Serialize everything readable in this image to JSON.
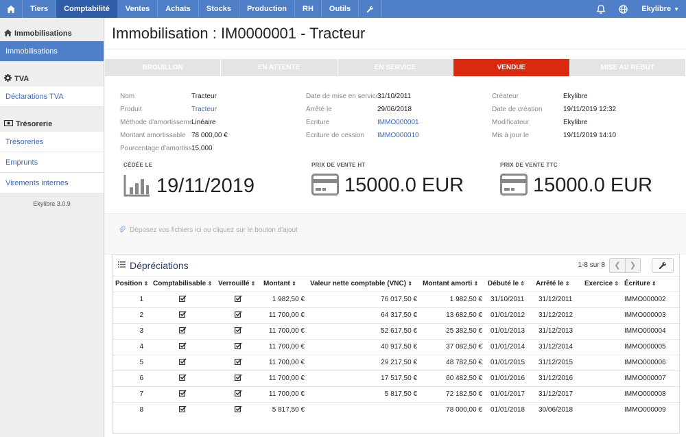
{
  "topbar": {
    "nav": [
      {
        "label": "Tiers",
        "active": false
      },
      {
        "label": "Comptabilité",
        "active": true
      },
      {
        "label": "Ventes",
        "active": false
      },
      {
        "label": "Achats",
        "active": false
      },
      {
        "label": "Stocks",
        "active": false
      },
      {
        "label": "Production",
        "active": false
      },
      {
        "label": "RH",
        "active": false
      },
      {
        "label": "Outils",
        "active": false
      }
    ],
    "user": "Ekylibre"
  },
  "sidebar": {
    "sections": [
      {
        "title": "Immobilisations",
        "icon": "home-icon",
        "links": [
          {
            "label": "Immobilisations",
            "active": true
          }
        ]
      },
      {
        "title": "TVA",
        "icon": "gear-icon",
        "links": [
          {
            "label": "Déclarations TVA",
            "active": false
          }
        ]
      },
      {
        "title": "Trésorerie",
        "icon": "banknote-icon",
        "links": [
          {
            "label": "Trésoreries",
            "active": false
          },
          {
            "label": "Emprunts",
            "active": false
          },
          {
            "label": "Virements internes",
            "active": false
          }
        ]
      }
    ],
    "version": "Ekylibre 3.0.9"
  },
  "page": {
    "title": "Immobilisation : IM0000001 - Tracteur"
  },
  "status": {
    "steps": [
      "Brouillon",
      "En attente",
      "En service",
      "Vendue",
      "Mise au rebut"
    ],
    "active": "Vendue",
    "active_color": "#d9290e"
  },
  "fields": {
    "col1": [
      {
        "label": "Nom",
        "value": "Tracteur",
        "link": false
      },
      {
        "label": "Produit",
        "value": "Tracteur",
        "link": true
      },
      {
        "label": "Méthode d'amortissement",
        "value": "Linéaire",
        "link": false
      },
      {
        "label": "Montant amortissable",
        "value": "78 000,00 €",
        "link": false
      },
      {
        "label": "Pourcentage d'amortissement",
        "value": "15,000",
        "link": false
      }
    ],
    "col2": [
      {
        "label": "Date de mise en service",
        "value": "31/10/2011",
        "link": false
      },
      {
        "label": "Arrêté le",
        "value": "29/06/2018",
        "link": false
      },
      {
        "label": "Écriture",
        "value": "IMMO000001",
        "link": true
      },
      {
        "label": "Ecriture de cession",
        "value": "IMMO000010",
        "link": true
      }
    ],
    "col3": [
      {
        "label": "Créateur",
        "value": "Ekylibre",
        "link": false
      },
      {
        "label": "Date de création",
        "value": "19/11/2019 12:32",
        "link": false
      },
      {
        "label": "Modificateur",
        "value": "Ekylibre",
        "link": false
      },
      {
        "label": "Mis à jour le",
        "value": "19/11/2019 14:10",
        "link": false
      }
    ]
  },
  "kpis": [
    {
      "label": "Cédée le",
      "value": "19/11/2019",
      "icon": "bar-chart-icon"
    },
    {
      "label": "Prix de vente HT",
      "value": "15000.0 EUR",
      "icon": "credit-card-icon"
    },
    {
      "label": "Prix de vente TTC",
      "value": "15000.0 EUR",
      "icon": "credit-card-icon"
    }
  ],
  "dropzone": {
    "text": "Déposez vos fichiers ici ou cliquez sur le bouton d'ajout"
  },
  "depreciations": {
    "title": "Dépréciations",
    "pager": "1-8 sur 8",
    "columns": [
      "Position",
      "Comptabilisable",
      "Verrouillé",
      "Montant",
      "Valeur nette comptable (VNC)",
      "Montant amorti",
      "Débuté le",
      "Arrêté le",
      "Exercice",
      "Écriture"
    ],
    "rows": [
      {
        "position": "1",
        "comptabilisable": true,
        "verrouille": true,
        "montant": "1 982,50 €",
        "vnc": "76 017,50 €",
        "amorti": "1 982,50 €",
        "debut": "31/10/2011",
        "arret": "31/12/2011",
        "exercice": "",
        "ecriture": "IMMO000002"
      },
      {
        "position": "2",
        "comptabilisable": true,
        "verrouille": true,
        "montant": "11 700,00 €",
        "vnc": "64 317,50 €",
        "amorti": "13 682,50 €",
        "debut": "01/01/2012",
        "arret": "31/12/2012",
        "exercice": "",
        "ecriture": "IMMO000003"
      },
      {
        "position": "3",
        "comptabilisable": true,
        "verrouille": true,
        "montant": "11 700,00 €",
        "vnc": "52 617,50 €",
        "amorti": "25 382,50 €",
        "debut": "01/01/2013",
        "arret": "31/12/2013",
        "exercice": "",
        "ecriture": "IMMO000004"
      },
      {
        "position": "4",
        "comptabilisable": true,
        "verrouille": true,
        "montant": "11 700,00 €",
        "vnc": "40 917,50 €",
        "amorti": "37 082,50 €",
        "debut": "01/01/2014",
        "arret": "31/12/2014",
        "exercice": "",
        "ecriture": "IMMO000005"
      },
      {
        "position": "5",
        "comptabilisable": true,
        "verrouille": true,
        "montant": "11 700,00 €",
        "vnc": "29 217,50 €",
        "amorti": "48 782,50 €",
        "debut": "01/01/2015",
        "arret": "31/12/2015",
        "exercice": "",
        "ecriture": "IMMO000006"
      },
      {
        "position": "6",
        "comptabilisable": true,
        "verrouille": true,
        "montant": "11 700,00 €",
        "vnc": "17 517,50 €",
        "amorti": "60 482,50 €",
        "debut": "01/01/2016",
        "arret": "31/12/2016",
        "exercice": "",
        "ecriture": "IMMO000007"
      },
      {
        "position": "7",
        "comptabilisable": true,
        "verrouille": true,
        "montant": "11 700,00 €",
        "vnc": "5 817,50 €",
        "amorti": "72 182,50 €",
        "debut": "01/01/2017",
        "arret": "31/12/2017",
        "exercice": "",
        "ecriture": "IMMO000008"
      },
      {
        "position": "8",
        "comptabilisable": true,
        "verrouille": true,
        "montant": "5 817,50 €",
        "vnc": "",
        "amorti": "78 000,00 €",
        "debut": "01/01/2018",
        "arret": "30/06/2018",
        "exercice": "",
        "ecriture": "IMMO000009"
      }
    ]
  },
  "colors": {
    "topbar": "#4f7fc7",
    "topbar_active": "#2f5da8",
    "link": "#3d68b6",
    "status_inactive": "#e4e4e4"
  }
}
